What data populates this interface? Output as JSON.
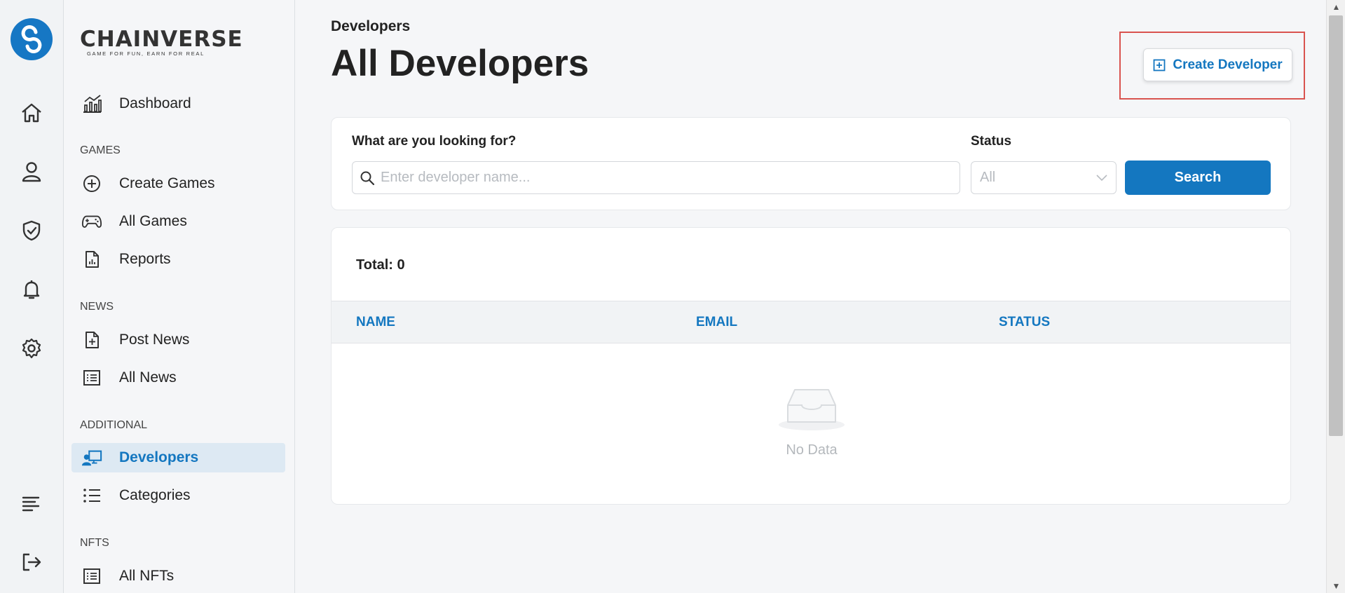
{
  "brand": {
    "name": "CHAINVERSE",
    "tagline": "GAME FOR FUN, EARN FOR REAL"
  },
  "rail": {
    "items": [
      {
        "icon": "home-icon"
      },
      {
        "icon": "user-icon"
      },
      {
        "icon": "shield-icon"
      },
      {
        "icon": "bell-icon"
      },
      {
        "icon": "gear-icon"
      },
      {
        "icon": "menu-icon"
      },
      {
        "icon": "logout-icon"
      }
    ]
  },
  "sidebar": {
    "dashboard": "Dashboard",
    "sections": {
      "games": "GAMES",
      "news": "NEWS",
      "additional": "ADDITIONAL",
      "nfts": "NFTS"
    },
    "items": {
      "create_games": "Create Games",
      "all_games": "All Games",
      "reports": "Reports",
      "post_news": "Post News",
      "all_news": "All News",
      "developers": "Developers",
      "categories": "Categories",
      "all_nfts": "All NFTs"
    },
    "active": "developers"
  },
  "page": {
    "breadcrumb": "Developers",
    "title": "All Developers",
    "create_button": "Create Developer"
  },
  "filters": {
    "search_label": "What are you looking for?",
    "search_placeholder": "Enter developer name...",
    "search_value": "",
    "status_label": "Status",
    "status_value": "All",
    "search_button": "Search"
  },
  "table": {
    "total": "Total: 0",
    "columns": [
      "NAME",
      "EMAIL",
      "STATUS"
    ],
    "rows": [],
    "empty_text": "No Data"
  },
  "colors": {
    "accent": "#1477c0",
    "highlight": "#d9534f"
  }
}
